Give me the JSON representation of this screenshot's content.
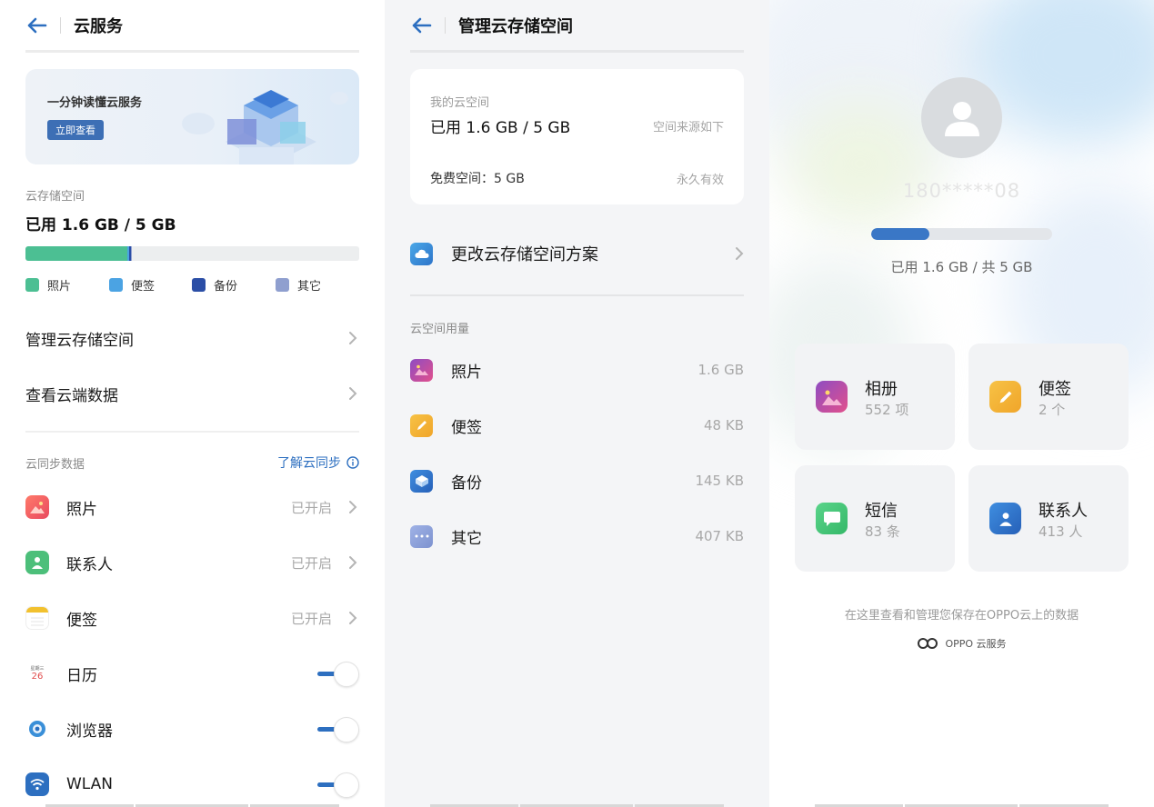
{
  "panel1": {
    "title": "云服务",
    "banner": {
      "text": "一分钟读懂云服务",
      "button": "立即查看"
    },
    "storage": {
      "label": "云存储空间",
      "usage": "已用 1.6 GB / 5 GB",
      "used_fraction": 0.32,
      "legend": [
        {
          "label": "照片",
          "color": "#4cbf93"
        },
        {
          "label": "便签",
          "color": "#4ba3e3"
        },
        {
          "label": "备份",
          "color": "#2b4ea6"
        },
        {
          "label": "其它",
          "color": "#8f9fcf"
        }
      ]
    },
    "menu": [
      {
        "label": "管理云存储空间"
      },
      {
        "label": "查看云端数据"
      }
    ],
    "sync": {
      "section": "云同步数据",
      "learn": "了解云同步",
      "items": [
        {
          "label": "照片",
          "status": "已开启",
          "icon": "photos-icon"
        },
        {
          "label": "联系人",
          "status": "已开启",
          "icon": "contacts-icon"
        },
        {
          "label": "便签",
          "status": "已开启",
          "icon": "notes-icon"
        },
        {
          "label": "日历",
          "icon": "calendar-icon",
          "calendar_top": "星期三",
          "calendar_day": "26",
          "toggle": true
        },
        {
          "label": "浏览器",
          "icon": "browser-icon",
          "toggle": true
        },
        {
          "label": "WLAN",
          "icon": "wifi-icon",
          "toggle": true
        }
      ]
    }
  },
  "panel2": {
    "title": "管理云存储空间",
    "card": {
      "label": "我的云空间",
      "usage": "已用 1.6 GB / 5 GB",
      "source": "空间来源如下",
      "free": "免费空间：5 GB",
      "validity": "永久有效"
    },
    "change_plan": "更改云存储空间方案",
    "section": "云空间用量",
    "items": [
      {
        "label": "照片",
        "value": "1.6 GB",
        "icon": "photos-icon"
      },
      {
        "label": "便签",
        "value": "48 KB",
        "icon": "notes-icon"
      },
      {
        "label": "备份",
        "value": "145 KB",
        "icon": "backup-icon"
      },
      {
        "label": "其它",
        "value": "407 KB",
        "icon": "other-icon"
      }
    ]
  },
  "panel3": {
    "account": "180*****08",
    "used_fraction": 0.32,
    "usage": "已用 1.6 GB / 共 5 GB",
    "tiles": [
      {
        "name": "相册",
        "count": "552 项",
        "icon": "album-icon"
      },
      {
        "name": "便签",
        "count": "2 个",
        "icon": "notes-icon"
      },
      {
        "name": "短信",
        "count": "83 条",
        "icon": "messages-icon"
      },
      {
        "name": "联系人",
        "count": "413 人",
        "icon": "contacts-icon"
      }
    ],
    "footer": "在这里查看和管理您保存在OPPO云上的数据",
    "brand": "OPPO 云服务"
  },
  "colors": {
    "accent": "#2d6fc0",
    "photos": "#4cbf93",
    "notes": "#f2b33a"
  }
}
